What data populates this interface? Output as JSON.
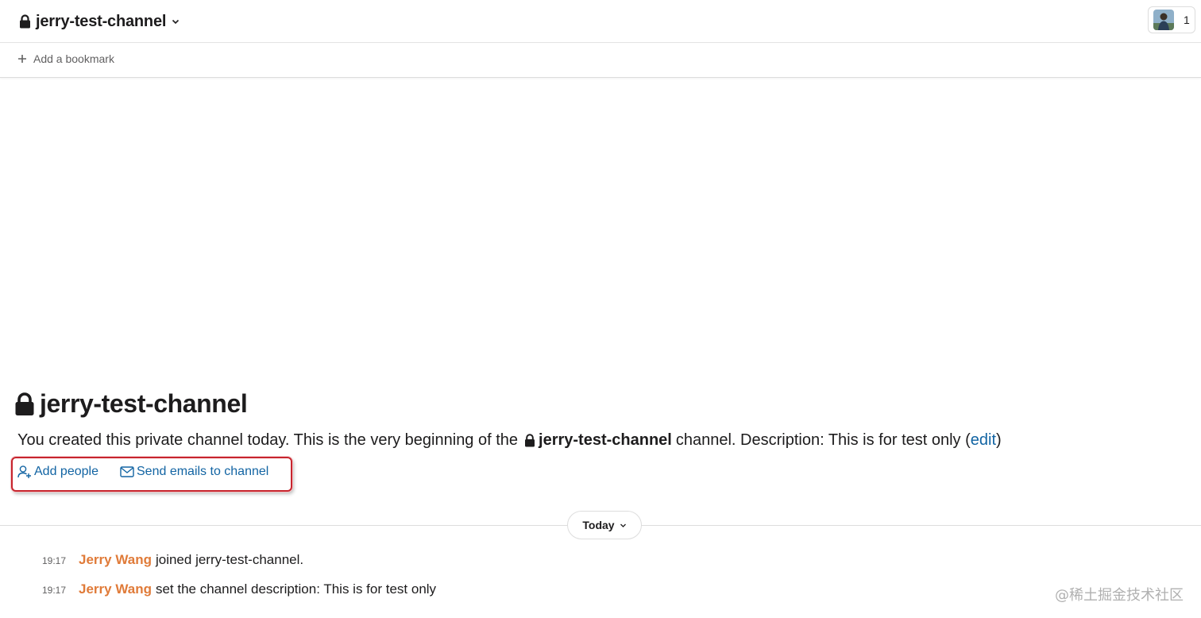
{
  "header": {
    "channel_name": "jerry-test-channel",
    "member_count": "1"
  },
  "bookmarks": {
    "add_label": "Add a bookmark"
  },
  "intro": {
    "title": "jerry-test-channel",
    "desc_prefix": "You created this private channel today. This is the very beginning of the",
    "channel_name": "jerry-test-channel",
    "desc_suffix": "channel. Description: This is for test only (",
    "edit_label": "edit",
    "close_paren": ")"
  },
  "actions": {
    "add_people": "Add people",
    "send_emails": "Send emails to channel"
  },
  "date_divider": {
    "label": "Today"
  },
  "messages": [
    {
      "time": "19:17",
      "author": "Jerry Wang",
      "text": "joined jerry-test-channel."
    },
    {
      "time": "19:17",
      "author": "Jerry Wang",
      "text": "set the channel description: This is for test only"
    }
  ],
  "watermark": "@稀土掘金技术社区",
  "colors": {
    "link": "#1264a3",
    "author": "#e07b39",
    "highlight_border": "#c7252e",
    "text": "#1d1c1d",
    "muted": "#616061"
  },
  "icons": {
    "lock": "lock-icon",
    "chevron": "chevron-down-icon",
    "plus": "plus-icon",
    "add_person": "add-person-icon",
    "email": "email-icon",
    "avatar": "avatar"
  }
}
